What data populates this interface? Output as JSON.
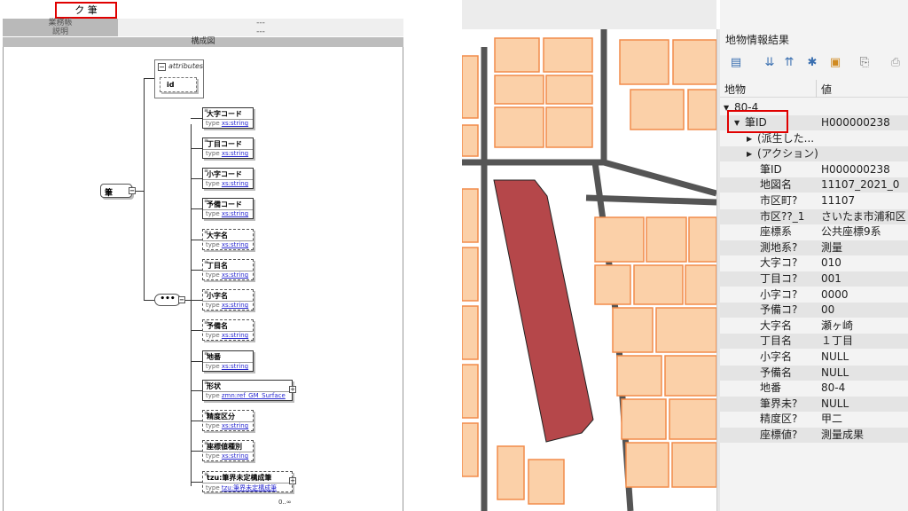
{
  "schema": {
    "header_tab": "ク 筆",
    "meta_rows": [
      {
        "key": "業務帳",
        "value": "---"
      },
      {
        "key": "説明",
        "value": "---"
      }
    ],
    "section_label": "構成図",
    "attributes_label": "attributes",
    "attribute_id": "id",
    "root_element": "筆",
    "sequence_symbol": "•••",
    "elements": [
      {
        "name": "大字コード",
        "type_prefix": "type",
        "type": "xs:string",
        "style": "solid"
      },
      {
        "name": "丁目コード",
        "type_prefix": "type",
        "type": "xs:string",
        "style": "solid"
      },
      {
        "name": "小字コード",
        "type_prefix": "type",
        "type": "xs:string",
        "style": "solid"
      },
      {
        "name": "予備コード",
        "type_prefix": "type",
        "type": "xs:string",
        "style": "solid"
      },
      {
        "name": "大字名",
        "type_prefix": "type",
        "type": "xs:string",
        "style": "dashed"
      },
      {
        "name": "丁目名",
        "type_prefix": "type",
        "type": "xs:string",
        "style": "dashed"
      },
      {
        "name": "小字名",
        "type_prefix": "type",
        "type": "xs:string",
        "style": "dashed"
      },
      {
        "name": "予備名",
        "type_prefix": "type",
        "type": "xs:string",
        "style": "dashed"
      },
      {
        "name": "地番",
        "type_prefix": "type",
        "type": "xs:string",
        "style": "solid"
      },
      {
        "name": "形状",
        "type_prefix": "type",
        "type": "zmn:ref_GM_Surface",
        "style": "solid"
      },
      {
        "name": "精度区分",
        "type_prefix": "type",
        "type": "xs:string",
        "style": "dashed"
      },
      {
        "name": "座標値種別",
        "type_prefix": "type",
        "type": "xs:string",
        "style": "dashed"
      },
      {
        "name": "tzu:筆界未定構成筆",
        "type_prefix": "type",
        "type": "tzu:筆界未定構成筆",
        "style": "dashed"
      }
    ],
    "occurrence": "0..∞"
  },
  "panel": {
    "title": "地物情報結果",
    "columns": {
      "feature": "地物",
      "value": "値"
    },
    "toolbar_icons": [
      "expand-tree-icon",
      "expand-all-icon",
      "collapse-all-icon",
      "select-icon",
      "highlight-icon",
      "copy-icon",
      "print-icon"
    ],
    "root_label": "80-4",
    "rows": [
      {
        "key": "筆ID",
        "value": "H000000238",
        "level": 1,
        "arrow": "down",
        "alt": true
      },
      {
        "key": "(派生した...",
        "value": "",
        "level": 2,
        "arrow": "right",
        "alt": false
      },
      {
        "key": "(アクション)",
        "value": "",
        "level": 2,
        "arrow": "right",
        "alt": true
      },
      {
        "key": "筆ID",
        "value": "H000000238",
        "level": 3,
        "arrow": "",
        "alt": false
      },
      {
        "key": "地図名",
        "value": "11107_2021_0",
        "level": 3,
        "arrow": "",
        "alt": true
      },
      {
        "key": "市区町?",
        "value": "11107",
        "level": 3,
        "arrow": "",
        "alt": false
      },
      {
        "key": "市区??_1",
        "value": "さいたま市浦和区",
        "level": 3,
        "arrow": "",
        "alt": true
      },
      {
        "key": "座標系",
        "value": "公共座標9系",
        "level": 3,
        "arrow": "",
        "alt": false
      },
      {
        "key": "測地系?",
        "value": "測量",
        "level": 3,
        "arrow": "",
        "alt": true
      },
      {
        "key": "大字コ?",
        "value": "010",
        "level": 3,
        "arrow": "",
        "alt": false
      },
      {
        "key": "丁目コ?",
        "value": "001",
        "level": 3,
        "arrow": "",
        "alt": true
      },
      {
        "key": "小字コ?",
        "value": "0000",
        "level": 3,
        "arrow": "",
        "alt": false
      },
      {
        "key": "予備コ?",
        "value": "00",
        "level": 3,
        "arrow": "",
        "alt": true
      },
      {
        "key": "大字名",
        "value": "瀬ヶ崎",
        "level": 3,
        "arrow": "",
        "alt": false
      },
      {
        "key": "丁目名",
        "value": "１丁目",
        "level": 3,
        "arrow": "",
        "alt": true
      },
      {
        "key": "小字名",
        "value": "NULL",
        "level": 3,
        "arrow": "",
        "alt": false
      },
      {
        "key": "予備名",
        "value": "NULL",
        "level": 3,
        "arrow": "",
        "alt": true
      },
      {
        "key": "地番",
        "value": "80-4",
        "level": 3,
        "arrow": "",
        "alt": false
      },
      {
        "key": "筆界未?",
        "value": "NULL",
        "level": 3,
        "arrow": "",
        "alt": true
      },
      {
        "key": "精度区?",
        "value": "甲二",
        "level": 3,
        "arrow": "",
        "alt": false
      },
      {
        "key": "座標値?",
        "value": "測量成果",
        "level": 3,
        "arrow": "",
        "alt": true
      }
    ]
  },
  "colors": {
    "highlight": "#e00000",
    "parcel_fill": "#fbd0a8",
    "parcel_stroke": "#f28c4a",
    "selected_parcel": "#b5474a",
    "road": "#555555"
  }
}
